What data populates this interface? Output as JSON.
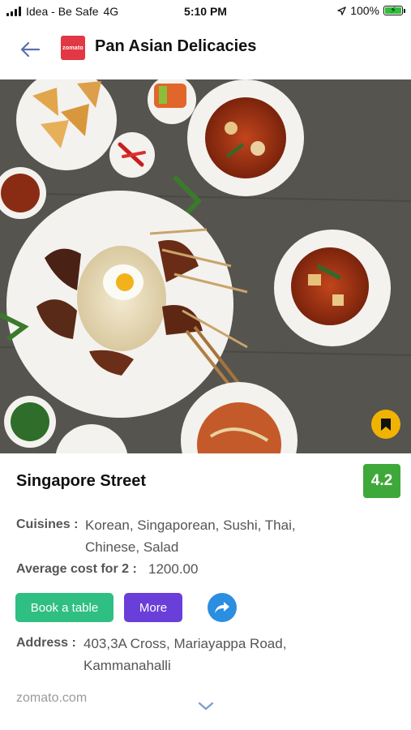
{
  "status_bar": {
    "carrier": "Idea - Be Safe",
    "network": "4G",
    "time": "5:10 PM",
    "battery": "100%",
    "battery_color": "#2fbf3a"
  },
  "header": {
    "title": "Pan Asian Delicacies",
    "logo_text": "zomato",
    "logo_color": "#e23744"
  },
  "hero": {
    "icon": "bookmark-icon",
    "bookmark_color": "#f0b400"
  },
  "restaurant": {
    "name": "Singapore Street",
    "rating": "4.2",
    "rating_color": "#3fa83a",
    "cuisines_label": "Cuisines :",
    "cuisines_line1": "Korean, Singaporean, Sushi, Thai,",
    "cuisines_line2": "Chinese, Salad",
    "cost_label": "Average cost for 2 :",
    "cost_value": "1200.00",
    "address_label": "Address :",
    "address_line1": "403,3A Cross, Mariayappa Road,",
    "address_line2": "Kammanahalli"
  },
  "actions": {
    "book_label": "Book a table",
    "book_color": "#2fbf82",
    "more_label": "More",
    "more_color": "#6a3fd9",
    "share_icon": "share-icon",
    "share_color": "#2c8ee0"
  },
  "footer": {
    "brand": "zomato.com",
    "expand_icon": "chevron-down-icon"
  }
}
